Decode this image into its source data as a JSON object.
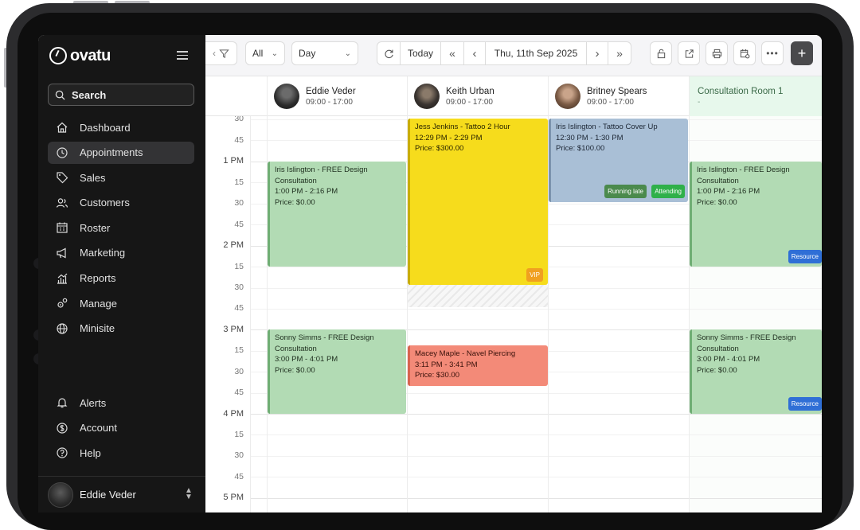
{
  "app": {
    "brand": "ovatu"
  },
  "search": {
    "label": "Search"
  },
  "sidebar": {
    "items": [
      {
        "label": "Dashboard",
        "icon": "house-icon"
      },
      {
        "label": "Appointments",
        "icon": "clock-icon",
        "active": true
      },
      {
        "label": "Sales",
        "icon": "tag-icon"
      },
      {
        "label": "Customers",
        "icon": "users-icon"
      },
      {
        "label": "Roster",
        "icon": "calendar-grid-icon"
      },
      {
        "label": "Marketing",
        "icon": "megaphone-icon"
      },
      {
        "label": "Reports",
        "icon": "chart-icon"
      },
      {
        "label": "Manage",
        "icon": "gears-icon"
      },
      {
        "label": "Minisite",
        "icon": "globe-icon"
      }
    ],
    "bottom": [
      {
        "label": "Alerts",
        "icon": "bell-icon"
      },
      {
        "label": "Account",
        "icon": "account-icon"
      },
      {
        "label": "Help",
        "icon": "help-icon"
      }
    ],
    "user": {
      "name": "Eddie Veder"
    }
  },
  "toolbar": {
    "filter_all": "All",
    "view": "Day",
    "today": "Today",
    "date": "Thu, 11th Sep 2025"
  },
  "columns": [
    {
      "name": "Eddie Veder",
      "hours": "09:00 - 17:00",
      "type": "staff"
    },
    {
      "name": "Keith Urban",
      "hours": "09:00 - 17:00",
      "type": "staff"
    },
    {
      "name": "Britney Spears",
      "hours": "09:00 - 17:00",
      "type": "staff"
    },
    {
      "name": "Consultation Room 1",
      "hours": "-",
      "type": "room"
    }
  ],
  "time_labels": [
    "30",
    "45",
    "1 PM",
    "15",
    "30",
    "45",
    "2 PM",
    "15",
    "30",
    "45",
    "3 PM",
    "15",
    "30",
    "45",
    "4 PM",
    "15",
    "30",
    "45",
    "5 PM"
  ],
  "appointments": [
    {
      "title": "Iris Islington - FREE Design Consultation",
      "time": "1:00 PM - 2:16 PM",
      "price": "Price: $0.00",
      "color": "#b2dbb4"
    },
    {
      "title": "Jess Jenkins - Tattoo 2 Hour",
      "time": "12:29 PM - 2:29 PM",
      "price": "Price: $300.00",
      "color": "#f6dc1c",
      "badge": "VIP"
    },
    {
      "title": "Iris Islington - Tattoo Cover Up",
      "time": "12:30 PM - 1:30 PM",
      "price": "Price: $100.00",
      "color": "#a9bfd6",
      "badges": [
        "Running late",
        "Attending"
      ]
    },
    {
      "title": "Iris Islington - FREE Design Consultation",
      "time": "1:00 PM - 2:16 PM",
      "price": "Price: $0.00",
      "color": "#b2dbb4",
      "badge": "Resource"
    },
    {
      "title": "Sonny Simms - FREE Design Consultation",
      "time": "3:00 PM - 4:01 PM",
      "price": "Price: $0.00",
      "color": "#b2dbb4"
    },
    {
      "title": "Macey Maple - Navel Piercing",
      "time": "3:11 PM - 3:41 PM",
      "price": "Price: $30.00",
      "color": "#f38a78"
    },
    {
      "title": "Sonny Simms - FREE Design Consultation",
      "time": "3:00 PM - 4:01 PM",
      "price": "Price: $0.00",
      "color": "#b2dbb4",
      "badge": "Resource"
    }
  ]
}
